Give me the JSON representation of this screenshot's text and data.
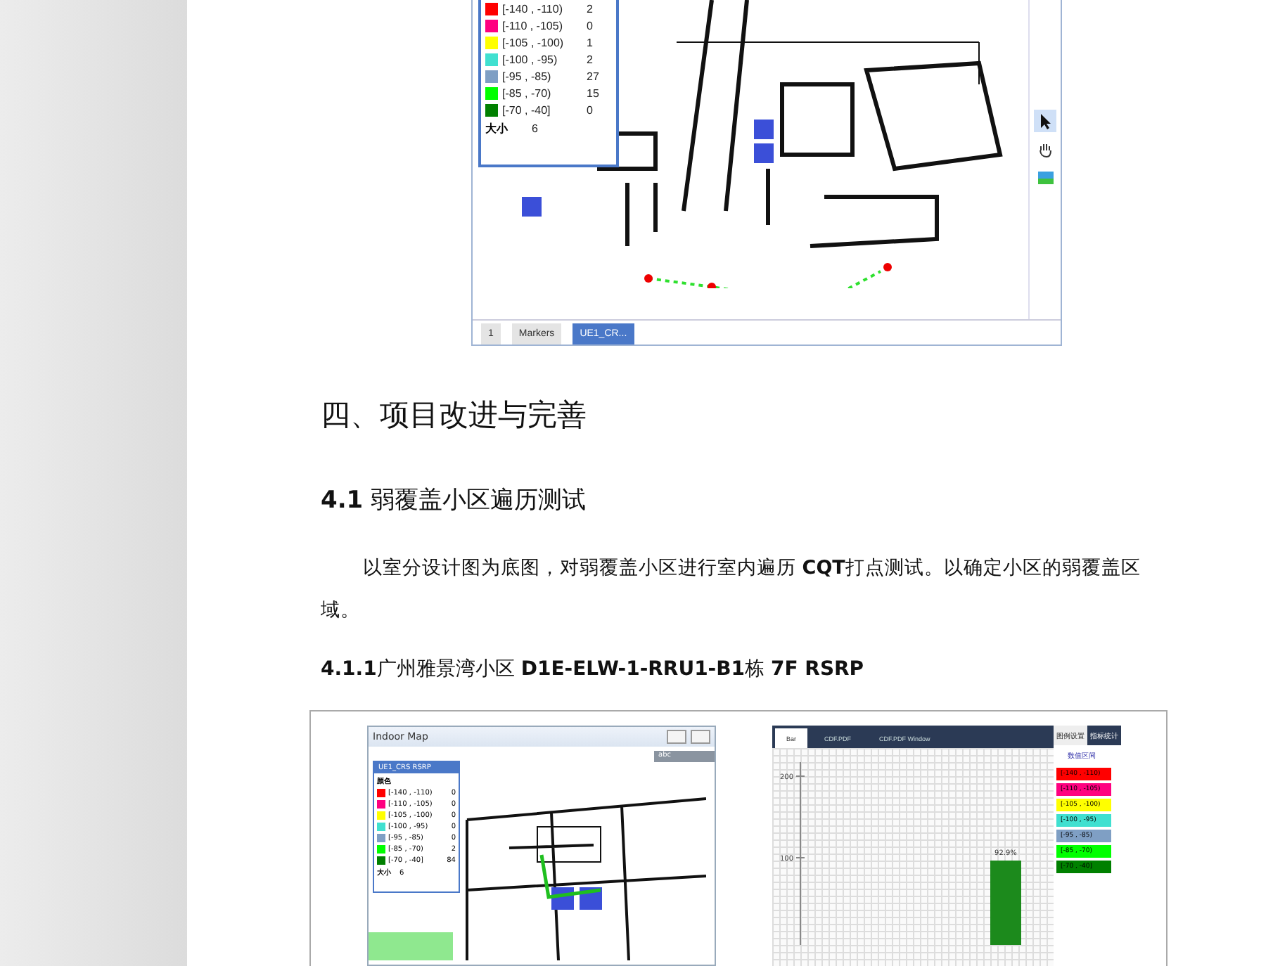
{
  "figure_top": {
    "legend": {
      "rows": [
        {
          "range": "[-140 , -110)",
          "count": "2",
          "color": "#ff0000"
        },
        {
          "range": "[-110 , -105)",
          "count": "0",
          "color": "#ff0080"
        },
        {
          "range": "[-105 , -100)",
          "count": "1",
          "color": "#ffff00"
        },
        {
          "range": "[-100 , -95)",
          "count": "2",
          "color": "#40e0d0"
        },
        {
          "range": "[-95 , -85)",
          "count": "27",
          "color": "#7f9fc4"
        },
        {
          "range": "[-85 , -70)",
          "count": "15",
          "color": "#00ff00"
        },
        {
          "range": "[-70 , -40]",
          "count": "0",
          "color": "#008000"
        }
      ],
      "size_label": "大小",
      "size_value": "6"
    },
    "tabs": [
      {
        "label": "1",
        "selected": false
      },
      {
        "label": "Markers",
        "selected": false
      },
      {
        "label": "UE1_CR...",
        "selected": true
      }
    ]
  },
  "heading_1": "四、项目改进与完善",
  "heading_2": "**4.1** 弱覆盖小区遍历测试",
  "paragraph": "以室分设计图为底图，对弱覆盖小区进行室内遍历 **CQT**打点测试。以确定小区的弱覆盖区域。",
  "heading_3": "**4.1.1**广州雅景湾小区 **D1E-ELW-1-RRU1-B1**栋 **7F RSRP**",
  "figure_bottom": {
    "window_title": "Indoor Map",
    "search_value": "abc",
    "legend": {
      "title": "UE1_CRS RSRP",
      "color_label": "颜色",
      "rows": [
        {
          "range": "[-140 , -110)",
          "count": "0",
          "color": "#ff0000"
        },
        {
          "range": "[-110 , -105)",
          "count": "0",
          "color": "#ff0080"
        },
        {
          "range": "[-105 , -100)",
          "count": "0",
          "color": "#ffff00"
        },
        {
          "range": "[-100 , -95)",
          "count": "0",
          "color": "#40e0d0"
        },
        {
          "range": "[-95 , -85)",
          "count": "0",
          "color": "#7f9fc4"
        },
        {
          "range": "[-85 , -70)",
          "count": "2",
          "color": "#00ff00"
        },
        {
          "range": "[-70 , -40]",
          "count": "84",
          "color": "#008000"
        }
      ],
      "size_label": "大小",
      "size_value": "6"
    },
    "chart_tabs": [
      {
        "label": "Bar",
        "selected": true
      },
      {
        "label": "CDF.PDF",
        "selected": false
      },
      {
        "label": "CDF.PDF Window",
        "selected": false
      }
    ],
    "chart": {
      "tick_labels": [
        "200",
        "100"
      ],
      "bar_label": "92.9%"
    },
    "table_tabs": [
      {
        "label": "图例设置",
        "selected": false
      },
      {
        "label": "指标统计",
        "selected": true
      }
    ],
    "table_header": "数值区间",
    "table_rows": [
      {
        "range": "[-140 , -110)",
        "color": "#ff0000"
      },
      {
        "range": "[-110 , -105)",
        "color": "#ff0080"
      },
      {
        "range": "[-105 , -100)",
        "color": "#ffff00"
      },
      {
        "range": "[-100 , -95)",
        "color": "#40e0d0"
      },
      {
        "range": "[-95 , -85)",
        "color": "#7f9fc4"
      },
      {
        "range": "[-85 , -70)",
        "color": "#00ff00"
      },
      {
        "range": "[-70 , -40]",
        "color": "#008000"
      }
    ]
  }
}
